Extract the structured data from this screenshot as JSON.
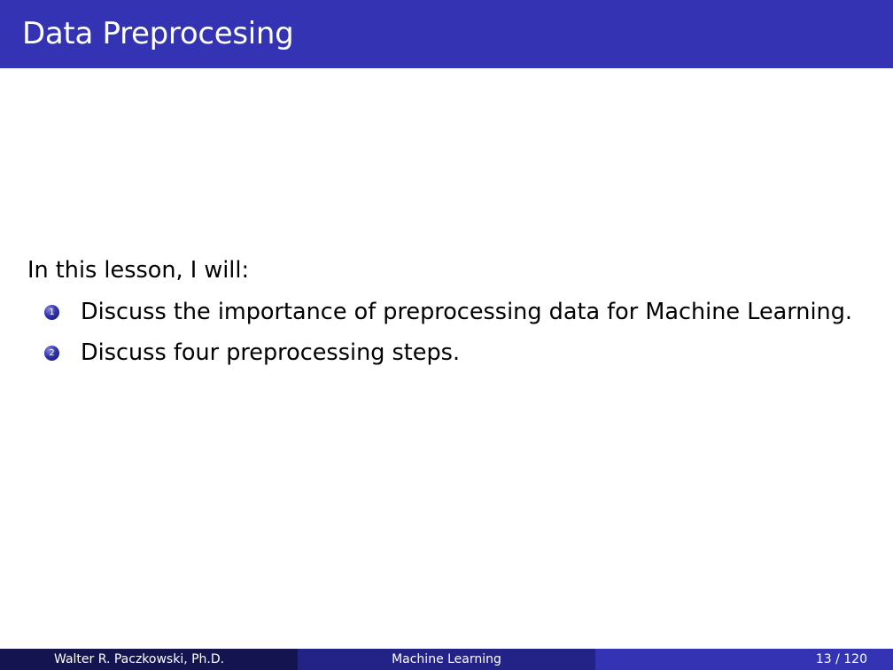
{
  "slide": {
    "title": "Data Preprocesing",
    "intro": "In this lesson, I will:",
    "items": [
      {
        "number": "1",
        "text": "Discuss the importance of preprocessing data for Machine Learning."
      },
      {
        "number": "2",
        "text": "Discuss four preprocessing steps."
      }
    ]
  },
  "footer": {
    "author": "Walter R. Paczkowski, Ph.D.",
    "course": "Machine Learning",
    "page": "13 / 120"
  },
  "colors": {
    "title_bar": "#3333b3",
    "footer_left": "#141450",
    "footer_middle": "#232387",
    "footer_right": "#3333b3"
  }
}
